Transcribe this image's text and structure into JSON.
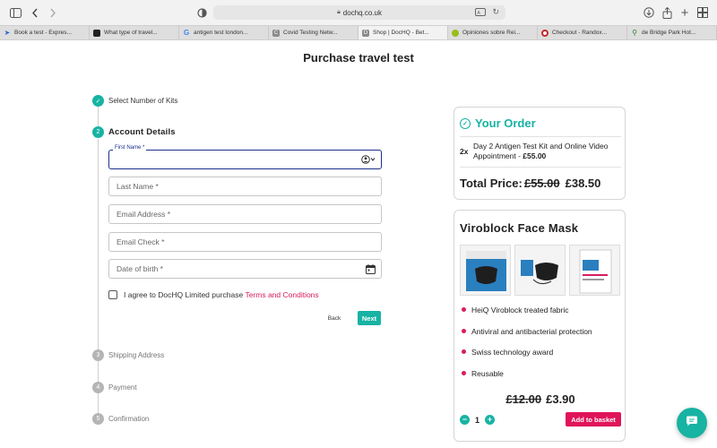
{
  "browser": {
    "url": "dochq.co.uk",
    "tabs": [
      {
        "label": "Book a test - Expres...",
        "color": "#2b67c7"
      },
      {
        "label": "What type of travel...",
        "color": "#222222"
      },
      {
        "label": "antigen test london...",
        "color": "#4285f4"
      },
      {
        "label": "Covid Testing Netw...",
        "color": "#8a8a8a"
      },
      {
        "label": "Shop | DocHQ - Bet...",
        "color": "#8a8a8a"
      },
      {
        "label": "Opiniones sobre Rei...",
        "color": "#9bbd1a"
      },
      {
        "label": "Checkout - Randox...",
        "color": "#c62828"
      },
      {
        "label": "de Bridge Park Hot...",
        "color": "#2e7d32"
      }
    ]
  },
  "page": {
    "title": "Purchase travel test"
  },
  "steps": [
    {
      "number": "✓",
      "label": "Select Number of Kits"
    },
    {
      "number": "2",
      "label": "Account Details"
    },
    {
      "number": "3",
      "label": "Shipping Address"
    },
    {
      "number": "4",
      "label": "Payment"
    },
    {
      "number": "5",
      "label": "Confirmation"
    }
  ],
  "form": {
    "first_name_label": "First Name *",
    "first_name_value": "",
    "last_name_placeholder": "Last Name *",
    "email_placeholder": "Email Address *",
    "email_check_placeholder": "Email Check *",
    "dob_placeholder": "Date of birth *",
    "agree_text": "I agree to DocHQ Limited purchase ",
    "terms_link": "Terms and Conditions",
    "back_label": "Back",
    "next_label": "Next"
  },
  "order": {
    "title": "Your Order",
    "quantity": "2x",
    "item_name": "Day 2 Antigen Test Kit and Online Video Appointment - ",
    "item_price": "£55.00",
    "total_label": "Total Price:",
    "total_old": "£55.00",
    "total_new": "£38.50"
  },
  "upsell": {
    "title": "Viroblock Face Mask",
    "features": [
      "HeiQ Viroblock treated fabric",
      "Antiviral and antibacterial protection",
      "Swiss technology award",
      "Reusable"
    ],
    "price_old": "£12.00",
    "price_new": "£3.90",
    "minus": "−",
    "plus": "+",
    "quantity": "1",
    "add_to_basket": "Add to basket"
  },
  "colors": {
    "accent": "#17b3a3",
    "brand_pink": "#e0145a",
    "focus_blue": "#1b2f8f"
  }
}
